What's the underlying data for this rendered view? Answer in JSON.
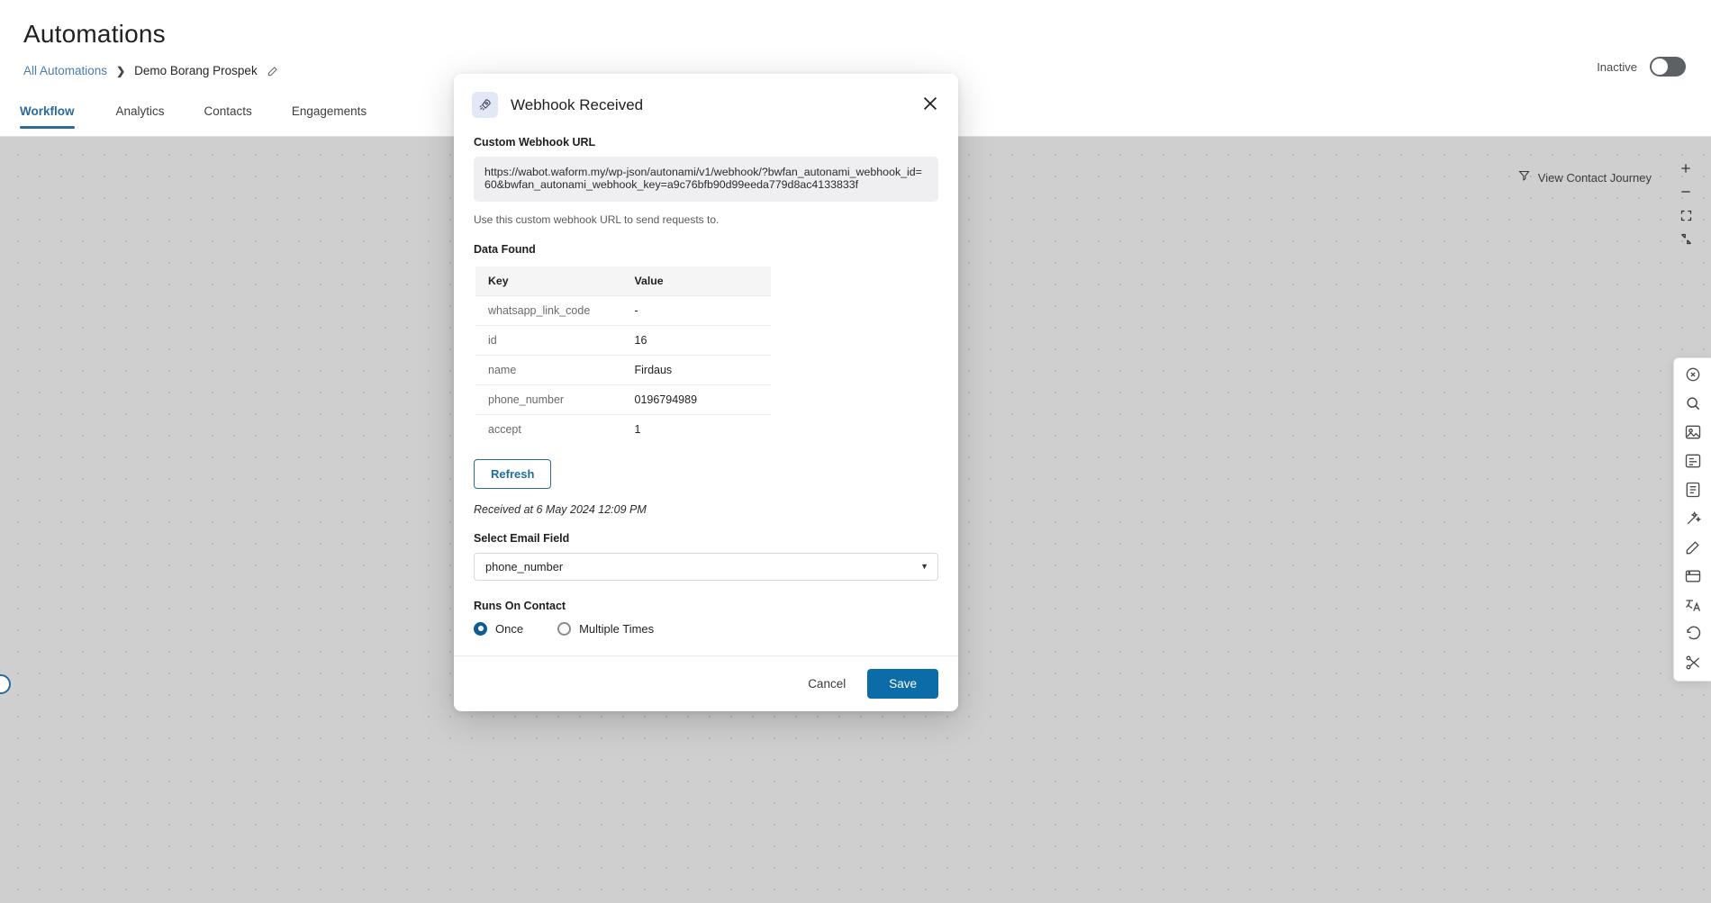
{
  "header": {
    "title": "Automations",
    "breadcrumb": {
      "root": "All Automations",
      "separator": "❯",
      "current": "Demo Borang Prospek"
    },
    "tabs": [
      {
        "label": "Workflow",
        "active": true
      },
      {
        "label": "Analytics",
        "active": false
      },
      {
        "label": "Contacts",
        "active": false
      },
      {
        "label": "Engagements",
        "active": false
      }
    ],
    "status_label": "Inactive"
  },
  "canvas": {
    "journey_button": "View Contact Journey",
    "zoom_controls": [
      "+",
      "−",
      "fit-icon",
      "expand-icon"
    ]
  },
  "modal": {
    "title": "Webhook Received",
    "icon": "rocket-icon",
    "close_icon": "close-icon",
    "webhook_url_label": "Custom Webhook URL",
    "webhook_url": "https://wabot.waform.my/wp-json/autonami/v1/webhook/?bwfan_autonami_webhook_id=60&bwfan_autonami_webhook_key=a9c76bfb90d99eeda779d8ac4133833f",
    "hint": "Use this custom webhook URL to send requests to.",
    "data_found_label": "Data Found",
    "table": {
      "columns": [
        "Key",
        "Value"
      ],
      "rows": [
        {
          "key": "whatsapp_link_code",
          "value": "-"
        },
        {
          "key": "id",
          "value": "16"
        },
        {
          "key": "name",
          "value": "Firdaus"
        },
        {
          "key": "phone_number",
          "value": "0196794989"
        },
        {
          "key": "accept",
          "value": "1"
        }
      ]
    },
    "refresh_label": "Refresh",
    "received_text": "Received at 6 May 2024 12:09 PM",
    "select_email_label": "Select Email Field",
    "select_email_value": "phone_number",
    "runs_on_contact_label": "Runs On Contact",
    "runs_options": [
      {
        "label": "Once",
        "selected": true
      },
      {
        "label": "Multiple Times",
        "selected": false
      }
    ],
    "cancel_label": "Cancel",
    "save_label": "Save"
  },
  "colors": {
    "accent": "#0b6ca8",
    "link": "#4a7ca8",
    "canvas": "#cfcfcf"
  }
}
